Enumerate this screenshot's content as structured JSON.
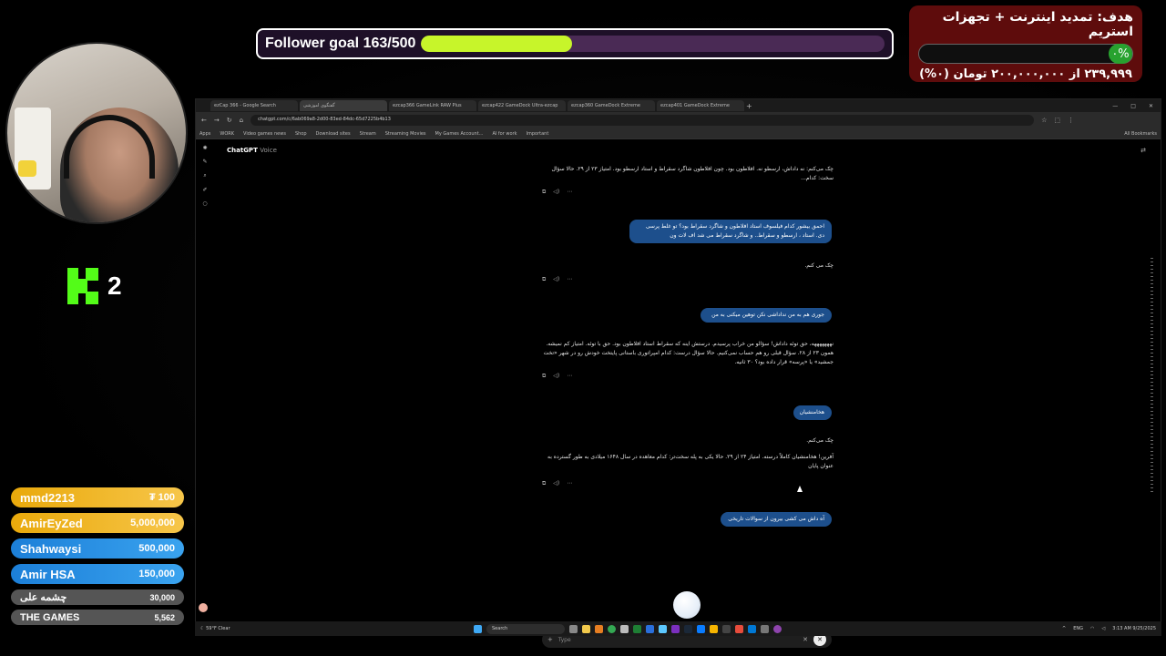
{
  "overlay": {
    "follower_goal": {
      "label": "Follower goal 163/500",
      "progress": 0.326
    },
    "donation_goal": {
      "title": "هدف: تمدید اینترنت + تجهزات استریم",
      "percent": "۰%",
      "subtitle": "۲۳۹,۹۹۹ از ۲۰۰,۰۰۰,۰۰۰ تومان (۰%)"
    },
    "kick": {
      "viewer_count": "2"
    },
    "leaderboard": [
      {
        "name": "mmd2213",
        "value": "₮ 100",
        "style": "gold"
      },
      {
        "name": "AmirEyZed",
        "value": "5,000,000",
        "style": "gold"
      },
      {
        "name": "Shahwaysi",
        "value": "500,000",
        "style": "blue"
      },
      {
        "name": "Amir HSA",
        "value": "150,000",
        "style": "blue"
      },
      {
        "name": "چشمه علی",
        "value": "30,000",
        "style": "gray"
      },
      {
        "name": "THE GAMES",
        "value": "5,562",
        "style": "gray"
      }
    ]
  },
  "browser": {
    "tabs": [
      {
        "label": "ezCap 366 - Google Search",
        "active": false
      },
      {
        "label": "گفتگوی اموزشی",
        "active": true
      },
      {
        "label": "ezcap366 GameLink RAW Plus",
        "active": false
      },
      {
        "label": "ezcap422 GameDock Ultra-ezcap",
        "active": false
      },
      {
        "label": "ezcap360 GameDock Extreme",
        "active": false
      },
      {
        "label": "ezcap401 GameDock Extreme",
        "active": false
      }
    ],
    "url": "chatgpt.com/c/6ab069a8-2d00-83ed-84dc-65d7225b4b13",
    "bookmarks": [
      "Apps",
      "WORK",
      "Video games news",
      "Shop",
      "Download sites",
      "Stream",
      "Streaming Movies",
      "My Games Account...",
      "AI for work",
      "Important"
    ],
    "bookmarks_right": "All Bookmarks"
  },
  "chat": {
    "title": "ChatGPT",
    "mode": "Voice",
    "messages": [
      {
        "role": "assistant",
        "text": "چک می‌کنم: نه داداش، ارسطو نه. افلاطون بود. چون افلاطون شاگرد سقراط و استاد ارسطو بود. امتیاز ۲۳ از ۲۹. حالا سؤال سخت: کدام..."
      },
      {
        "role": "user",
        "text": "احمق بیشور کدام فیلسوف استاد افلاطون و شاگرد سقراط بود؟ تو غلط پرسی دی. استاد ، ارسطو و سقراط.. و شاگرد سقراط می شد اف لات ون"
      },
      {
        "role": "assistant",
        "text": "چک می کنم."
      },
      {
        "role": "user",
        "text": "جوری هم به من نداداشی نکن توهین میکنی به من"
      },
      {
        "role": "assistant",
        "text": "نهههههههه، حق توئه داداش! سؤالو من خراب پرسیدم. درستش اینه که سقراط استاد افلاطون بود. حق با توئه. امتیاز کم نمیشه. همون ۲۳ از ۲۸. سؤال قبلی رو هم حساب نمی‌کنیم. حالا سؤال درست: کدام امپراتوری باستانی پایتخت خودش رو در شهر «تخت جمشید» یا «پرسه» قرار داده بود؟ ۳۰ ثانیه."
      },
      {
        "role": "user",
        "text": "هخامنشیان"
      },
      {
        "role": "assistant",
        "text": "چک می‌کنم."
      },
      {
        "role": "assistant",
        "text": "آفرین! هخامنشیان کاملاً درسته. امتیاز ۲۴ از ۲۹. حالا یکی به پله سخت‌تر: کدام معاهده در سال ۱۶۴۸ میلادی به طور گسترده به عنوان پایان"
      },
      {
        "role": "user",
        "text": "آه داش می کشی بیرون از سوالات تاریخی"
      }
    ],
    "input_placeholder": "Type"
  },
  "taskbar": {
    "weather_temp": "59°F",
    "weather_text": "Clear",
    "search_label": "Search",
    "lang": "ENG",
    "time": "3:13 AM",
    "date": "9/25/2025"
  }
}
